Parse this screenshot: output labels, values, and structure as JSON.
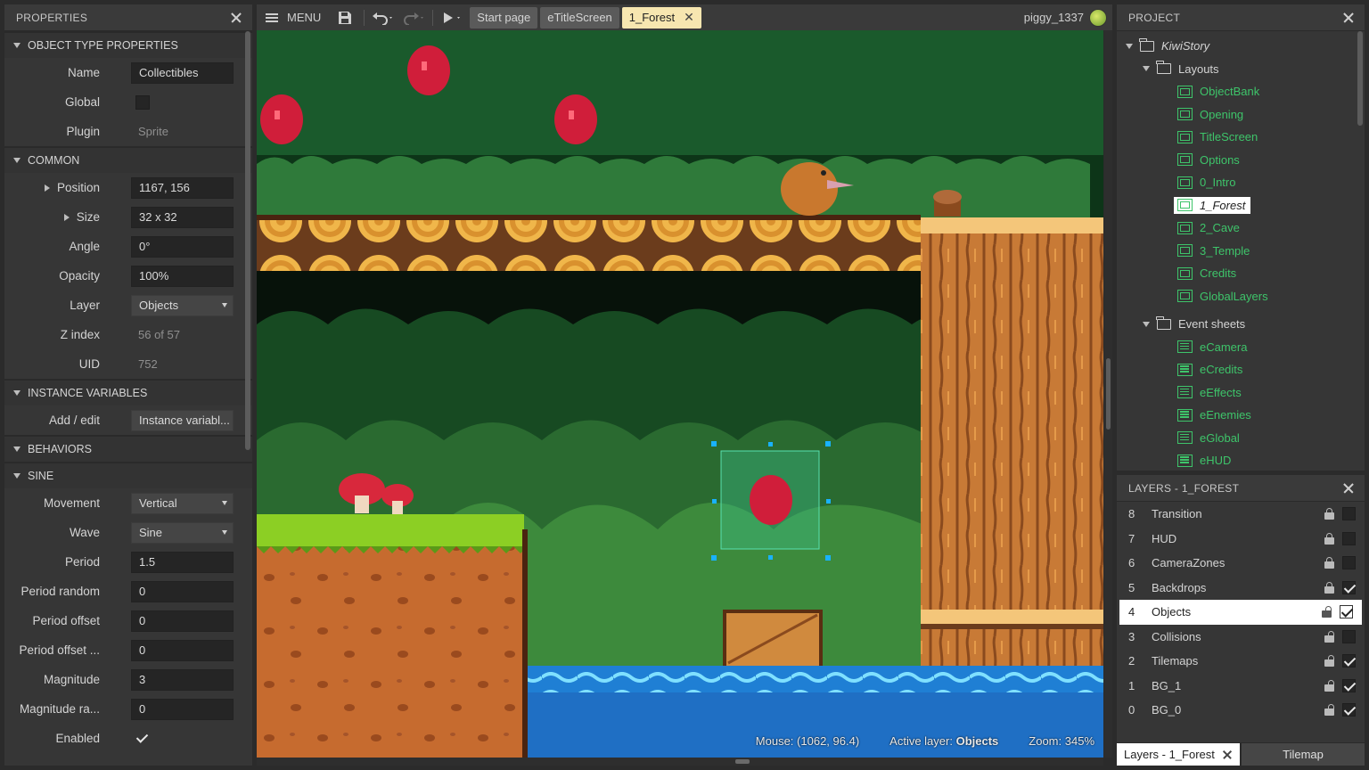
{
  "properties": {
    "title": "PROPERTIES",
    "sections": {
      "object_type": "OBJECT TYPE PROPERTIES",
      "common": "COMMON",
      "instance_vars": "INSTANCE VARIABLES",
      "behaviors": "BEHAVIORS",
      "sine": "SINE"
    },
    "name_label": "Name",
    "name_value": "Collectibles",
    "global_label": "Global",
    "plugin_label": "Plugin",
    "plugin_value": "Sprite",
    "position_label": "Position",
    "position_value": "1167, 156",
    "size_label": "Size",
    "size_value": "32 x 32",
    "angle_label": "Angle",
    "angle_value": "0°",
    "opacity_label": "Opacity",
    "opacity_value": "100%",
    "layer_label": "Layer",
    "layer_value": "Objects",
    "zindex_label": "Z index",
    "zindex_value": "56 of 57",
    "uid_label": "UID",
    "uid_value": "752",
    "addedit_label": "Add / edit",
    "addedit_value": "Instance variabl...",
    "movement_label": "Movement",
    "movement_value": "Vertical",
    "wave_label": "Wave",
    "wave_value": "Sine",
    "period_label": "Period",
    "period_value": "1.5",
    "period_random_label": "Period random",
    "period_random_value": "0",
    "period_offset_label": "Period offset",
    "period_offset_value": "0",
    "period_offset2_label": "Period offset ...",
    "period_offset2_value": "0",
    "magnitude_label": "Magnitude",
    "magnitude_value": "3",
    "magnitude_ra_label": "Magnitude ra...",
    "magnitude_ra_value": "0",
    "enabled_label": "Enabled"
  },
  "toolbar": {
    "menu_label": "MENU",
    "tabs": [
      "Start page",
      "eTitleScreen",
      "1_Forest"
    ],
    "username": "piggy_1337"
  },
  "status": {
    "mouse_label": "Mouse:",
    "mouse_value": "(1062, 96.4)",
    "active_layer_label": "Active layer:",
    "active_layer_value": "Objects",
    "zoom_label": "Zoom:",
    "zoom_value": "345%"
  },
  "project": {
    "title": "PROJECT",
    "root": "KiwiStory",
    "layouts_folder": "Layouts",
    "layouts": [
      "ObjectBank",
      "Opening",
      "TitleScreen",
      "Options",
      "0_Intro",
      "1_Forest",
      "2_Cave",
      "3_Temple",
      "Credits",
      "GlobalLayers"
    ],
    "events_folder": "Event sheets",
    "events": [
      "eCamera",
      "eCredits",
      "eEffects",
      "eEnemies",
      "eGlobal",
      "eHUD"
    ]
  },
  "layers": {
    "title": "LAYERS - 1_FOREST",
    "items": [
      {
        "n": "8",
        "name": "Transition",
        "visible": false
      },
      {
        "n": "7",
        "name": "HUD",
        "visible": false
      },
      {
        "n": "6",
        "name": "CameraZones",
        "visible": false
      },
      {
        "n": "5",
        "name": "Backdrops",
        "visible": true
      },
      {
        "n": "4",
        "name": "Objects",
        "visible": true
      },
      {
        "n": "3",
        "name": "Collisions",
        "visible": false
      },
      {
        "n": "2",
        "name": "Tilemaps",
        "visible": true
      },
      {
        "n": "1",
        "name": "BG_1",
        "visible": true
      },
      {
        "n": "0",
        "name": "BG_0",
        "visible": true
      }
    ]
  },
  "bottom_tabs": {
    "layers": "Layers - 1_Forest",
    "tilemap": "Tilemap"
  }
}
